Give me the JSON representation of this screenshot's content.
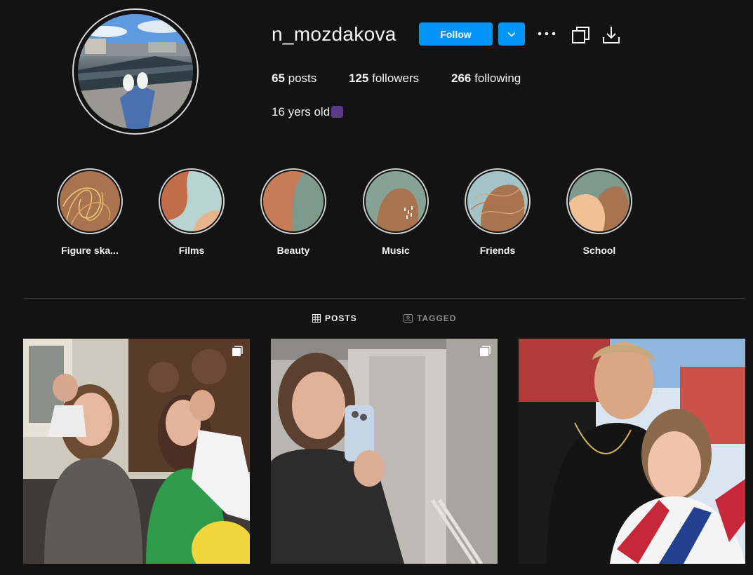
{
  "profile": {
    "username": "n_mozdakova",
    "follow_label": "Follow",
    "stats": {
      "posts_count": "65",
      "posts_label": " posts",
      "followers_count": "125",
      "followers_label": " followers",
      "following_count": "266",
      "following_label": " following"
    },
    "bio": "16 yers old"
  },
  "highlights": [
    {
      "label": "Figure ska..."
    },
    {
      "label": "Films"
    },
    {
      "label": "Beauty"
    },
    {
      "label": "Music"
    },
    {
      "label": "Friends"
    },
    {
      "label": "School"
    }
  ],
  "tabs": {
    "posts": "POSTS",
    "tagged": "TAGGED"
  },
  "colors": {
    "accent": "#0095f6",
    "background": "#131313",
    "highlight_brown": "#a8734f",
    "highlight_sage": "#7d9a8c",
    "highlight_peach": "#e8b48c",
    "highlight_rust": "#c36d4b"
  }
}
